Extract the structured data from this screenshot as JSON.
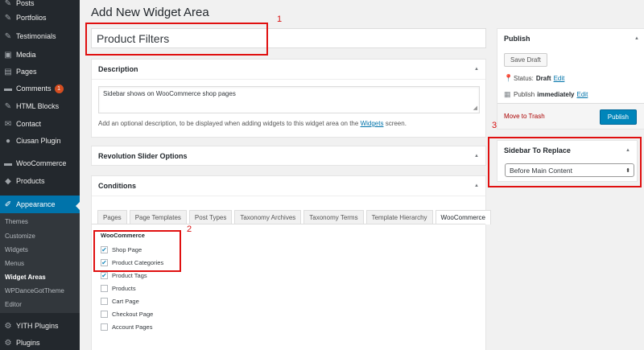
{
  "sidebar": {
    "items": [
      {
        "label": "Posts",
        "icon": "pushpin-icon"
      },
      {
        "label": "Portfolios",
        "icon": "pushpin-icon"
      },
      {
        "label": "Testimonials",
        "icon": "pushpin-icon"
      },
      {
        "label": "Media",
        "icon": "media-icon"
      },
      {
        "label": "Pages",
        "icon": "pages-icon"
      },
      {
        "label": "Comments",
        "icon": "comments-icon",
        "badge": "1"
      },
      {
        "label": "HTML Blocks",
        "icon": "pushpin-icon"
      },
      {
        "label": "Contact",
        "icon": "mail-icon"
      },
      {
        "label": "Ciusan Plugin",
        "icon": "plugin-icon"
      },
      {
        "label": "WooCommerce",
        "icon": "woocommerce-icon"
      },
      {
        "label": "Products",
        "icon": "products-icon"
      },
      {
        "label": "Appearance",
        "icon": "paintbrush-icon"
      },
      {
        "label": "YITH Plugins",
        "icon": "yith-icon"
      },
      {
        "label": "Plugins",
        "icon": "plugins-icon"
      }
    ],
    "submenu": [
      "Themes",
      "Customize",
      "Widgets",
      "Menus",
      "Widget Areas",
      "WPDanceGotTheme",
      "Editor"
    ],
    "current_submenu": "Widget Areas",
    "active_item": "Appearance"
  },
  "page": {
    "title": "Add New Widget Area",
    "name_value": "Product Filters"
  },
  "description_box": {
    "heading": "Description",
    "text": "Sidebar shows on WooCommerce shop pages",
    "help_before": "Add an optional description, to be displayed when adding widgets to this widget area on the ",
    "help_link": "Widgets",
    "help_after": " screen."
  },
  "revolution_box": {
    "heading": "Revolution Slider Options"
  },
  "conditions_box": {
    "heading": "Conditions",
    "tabs": [
      "Pages",
      "Page Templates",
      "Post Types",
      "Taxonomy Archives",
      "Taxonomy Terms",
      "Template Hierarchy",
      "WooCommerce"
    ],
    "active_tab": "WooCommerce",
    "section_heading": "WooCommerce",
    "options": [
      {
        "label": "Shop Page",
        "checked": true
      },
      {
        "label": "Product Categories",
        "checked": true
      },
      {
        "label": "Product Tags",
        "checked": true
      },
      {
        "label": "Products",
        "checked": false
      },
      {
        "label": "Cart Page",
        "checked": false
      },
      {
        "label": "Checkout Page",
        "checked": false
      },
      {
        "label": "Account Pages",
        "checked": false
      }
    ]
  },
  "publish_box": {
    "heading": "Publish",
    "save_draft": "Save Draft",
    "status_label": "Status:",
    "status_value": "Draft",
    "edit_label": "Edit",
    "publish_label": "Publish",
    "publish_value": "immediately",
    "trash_label": "Move to Trash",
    "publish_button": "Publish"
  },
  "sidebar_replace_box": {
    "heading": "Sidebar To Replace",
    "selected": "Before Main Content"
  },
  "annotations": [
    "1",
    "2",
    "3"
  ],
  "colors": {
    "admin_bar": "#23282d",
    "accent": "#0073aa",
    "primary_button": "#0085ba",
    "annotation_red": "#e01010",
    "trash": "#a00000"
  }
}
